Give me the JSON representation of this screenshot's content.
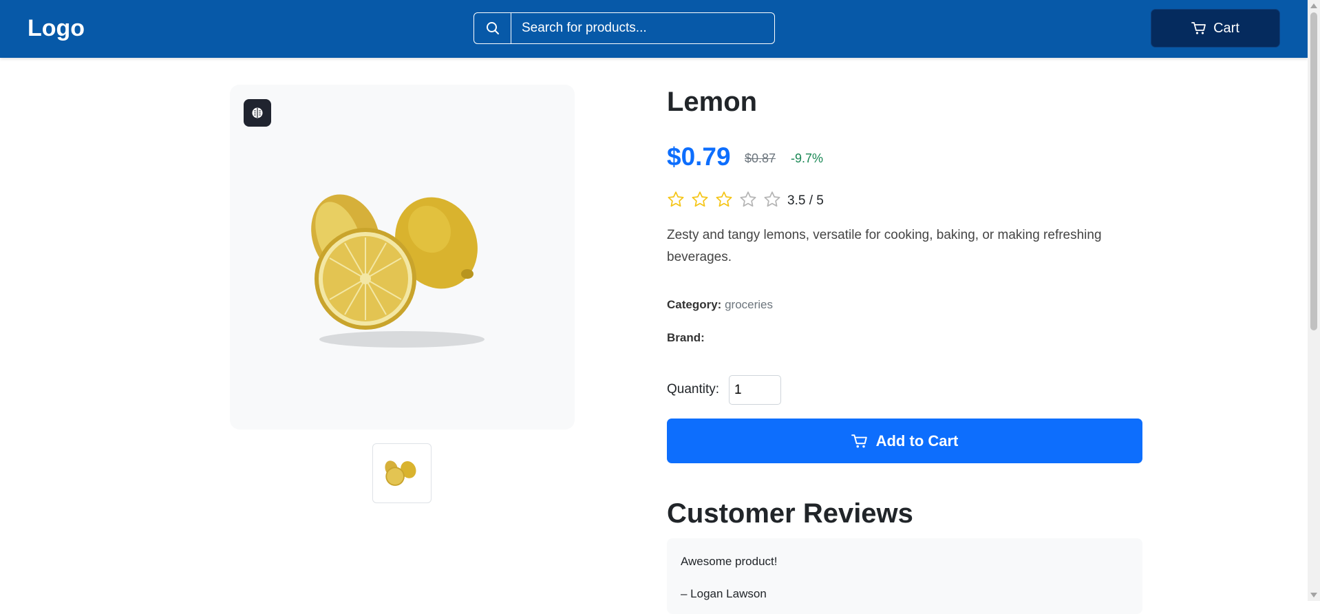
{
  "header": {
    "logo": "Logo",
    "search_placeholder": "Search for products...",
    "cart_label": "Cart"
  },
  "product": {
    "title": "Lemon",
    "price": "$0.79",
    "old_price": "$0.87",
    "discount": "-9.7%",
    "rating": 3.5,
    "rating_text": "3.5 / 5",
    "description": "Zesty and tangy lemons, versatile for cooking, baking, or making refreshing beverages.",
    "category_label": "Category:",
    "category_value": "groceries",
    "brand_label": "Brand:",
    "brand_value": "",
    "quantity_label": "Quantity:",
    "quantity_value": "1",
    "add_to_cart_label": "Add to Cart"
  },
  "reviews": {
    "title": "Customer Reviews",
    "items": [
      {
        "text": "Awesome product!",
        "author": "– Logan Lawson"
      }
    ]
  },
  "colors": {
    "navbar": "#0759a8",
    "cart_button": "#052b5e",
    "accent": "#0d6efd",
    "discount": "#198754",
    "star": "#f5c518"
  },
  "icons": {
    "search": "search-icon",
    "cart": "cart-icon",
    "ai_badge": "brain-icon",
    "star": "star-icon"
  }
}
